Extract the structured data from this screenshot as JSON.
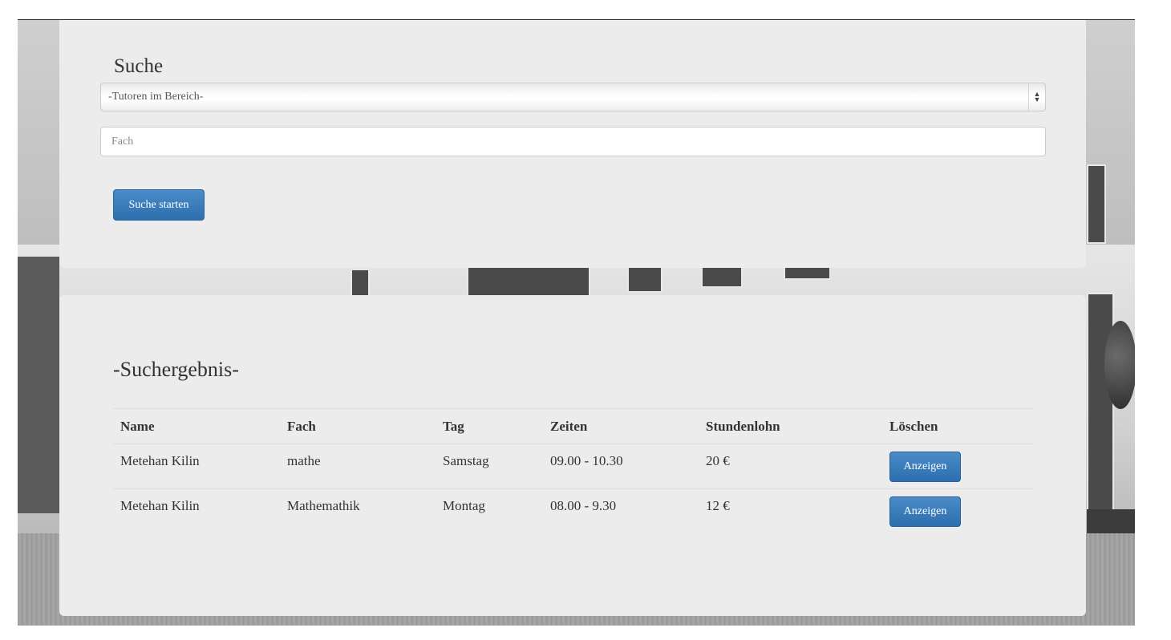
{
  "search": {
    "title": "Suche",
    "select_value": "-Tutoren im Bereich-",
    "input_placeholder": "Fach",
    "submit_label": "Suche starten"
  },
  "results": {
    "title": "-Suchergebnis-",
    "columns": [
      "Name",
      "Fach",
      "Tag",
      "Zeiten",
      "Stundenlohn",
      "Löschen"
    ],
    "rows": [
      {
        "name": "Metehan Kilin",
        "fach": "mathe",
        "tag": "Samstag",
        "zeiten": "09.00 - 10.30",
        "lohn": "20 €",
        "action": "Anzeigen"
      },
      {
        "name": "Metehan Kilin",
        "fach": "Mathemathik",
        "tag": "Montag",
        "zeiten": "08.00 - 9.30",
        "lohn": "12 €",
        "action": "Anzeigen"
      }
    ]
  },
  "colors": {
    "panel_bg": "#ececec",
    "button_primary": "#337ab7"
  }
}
